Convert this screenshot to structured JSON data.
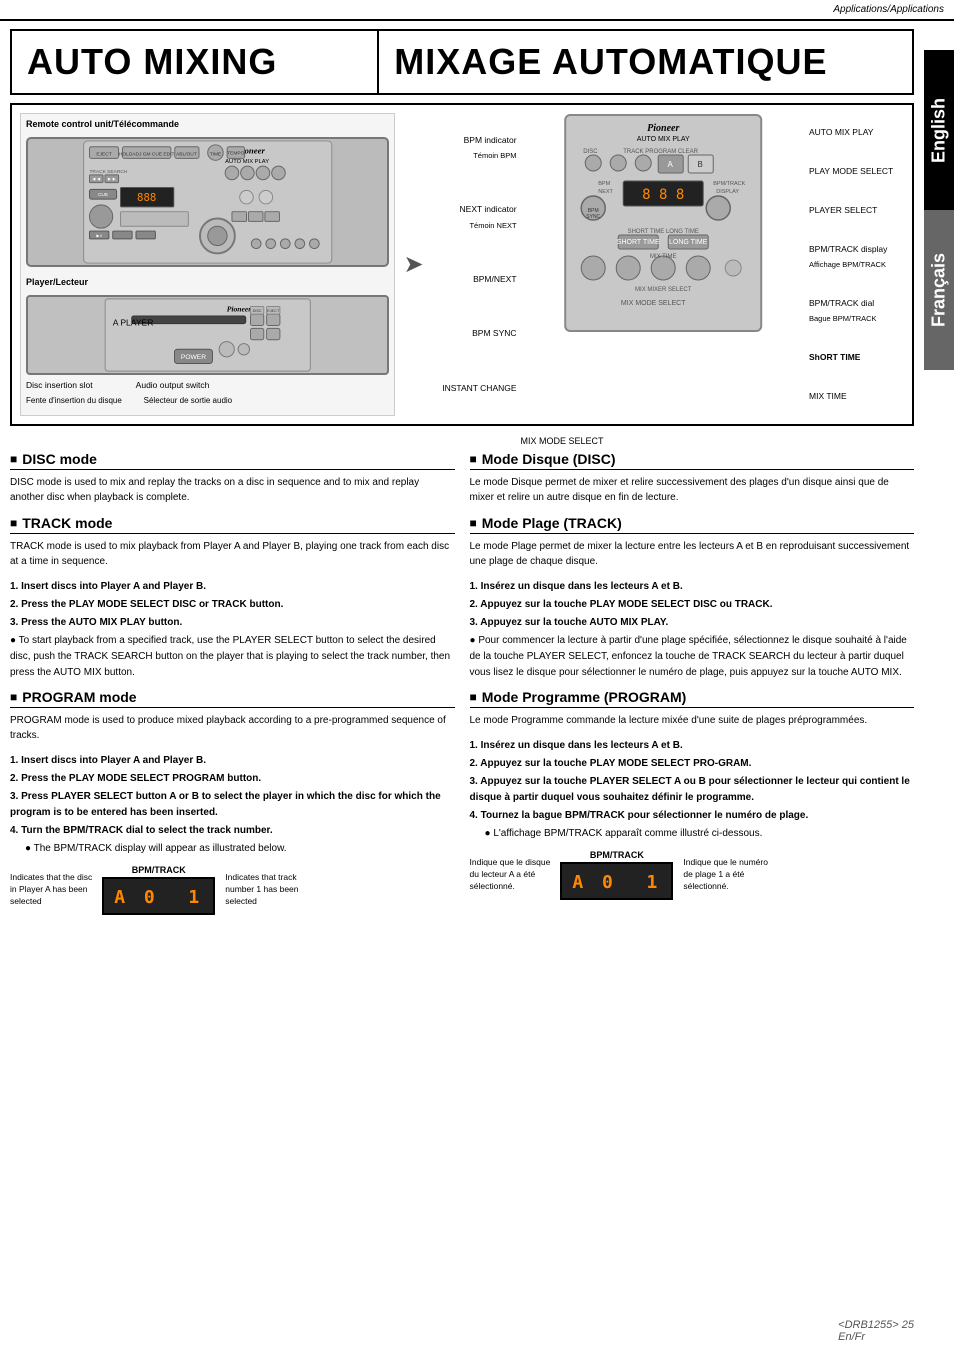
{
  "header": {
    "title": "Applications/Applications"
  },
  "side_tabs": [
    {
      "id": "english",
      "label": "English",
      "bg": "#000"
    },
    {
      "id": "francais",
      "label": "Français",
      "bg": "#555"
    }
  ],
  "titles": {
    "left": "AUTO MIXING",
    "right": "MIXAGE AUTOMATIQUE"
  },
  "diagram": {
    "remote_label": "Remote control unit/Télécommande",
    "player_label": "Player/Lecteur",
    "pioneer_logo": "Pioneer",
    "auto_mix_play": "AUTO MIX PLAY",
    "annotations_left": [
      {
        "id": "bpm-indicator",
        "label": "BPM indicator",
        "sublabel": "Témoin BPM"
      },
      {
        "id": "next-indicator",
        "label": "NEXT indicator",
        "sublabel": "Témoin NEXT"
      },
      {
        "id": "bpm-next",
        "label": "BPM/NEXT"
      },
      {
        "id": "bpm-sync",
        "label": "BPM SYNC"
      },
      {
        "id": "instant-change",
        "label": "INSTANT CHANGE"
      }
    ],
    "annotations_right": [
      {
        "id": "auto-mix-play",
        "label": "AUTO MIX PLAY"
      },
      {
        "id": "play-mode-select",
        "label": "PLAY MODE SELECT"
      },
      {
        "id": "player-select",
        "label": "PLAYER SELECT"
      },
      {
        "id": "bpm-track-display",
        "label": "BPM/TRACK display",
        "sublabel": "Affichage BPM/TRACK"
      },
      {
        "id": "bpm-track-dial",
        "label": "BPM/TRACK dial",
        "sublabel": "Bague BPM/TRACK"
      },
      {
        "id": "short-time",
        "label": "SHORT TIME"
      },
      {
        "id": "mix-time",
        "label": "MIX TIME"
      }
    ],
    "mix-mode-select": "MIX MODE SELECT",
    "disc_slot_label": "Disc insertion slot",
    "disc_slot_sublabel": "Fente d'insertion du disque",
    "audio_switch_label": "Audio output switch",
    "audio_switch_sublabel": "Sélecteur de sortie audio"
  },
  "sections": {
    "left": [
      {
        "id": "disc-mode",
        "title": "DISC mode",
        "body": "DISC mode is used to mix and replay the tracks on a disc in sequence and to mix and replay another disc when playback is complete."
      },
      {
        "id": "track-mode",
        "title": "TRACK mode",
        "body": "TRACK mode is used to mix playback from Player A and Player B, playing one track from each disc at a time in sequence."
      },
      {
        "id": "steps-disc-track",
        "steps": [
          {
            "type": "numbered",
            "text": "1. Insert discs into Player A and Player B."
          },
          {
            "type": "numbered",
            "text": "2. Press the PLAY MODE SELECT DISC or TRACK button."
          },
          {
            "type": "numbered",
            "text": "3. Press the AUTO MIX PLAY button."
          },
          {
            "type": "bullet",
            "text": "To start playback from a specified track, use the PLAYER SELECT button to select the desired disc, push the TRACK SEARCH button on the player that is playing to select the track number, then press the AUTO MIX button."
          }
        ]
      },
      {
        "id": "program-mode",
        "title": "PROGRAM mode",
        "body": "PROGRAM mode is used to produce mixed playback according to a pre-programmed sequence of tracks."
      },
      {
        "id": "steps-program",
        "steps": [
          {
            "type": "numbered",
            "text": "1. Insert discs into Player A and Player B."
          },
          {
            "type": "numbered",
            "text": "2. Press the PLAY MODE SELECT PROGRAM button."
          },
          {
            "type": "numbered",
            "text": "3. Press PLAYER SELECT button A or B to select the player in which the disc for which the program is to be entered has been inserted."
          },
          {
            "type": "numbered",
            "text": "4. Turn the BPM/TRACK dial to select the track number."
          },
          {
            "type": "sub-bullet",
            "text": "The BPM/TRACK display will appear as illustrated below."
          }
        ]
      }
    ],
    "right": [
      {
        "id": "mode-disque",
        "title": "Mode Disque (DISC)",
        "body": "Le mode Disque permet de mixer et relire successivement des plages d'un disque ainsi que de mixer et relire un autre disque en fin de lecture."
      },
      {
        "id": "mode-plage",
        "title": "Mode Plage (TRACK)",
        "body": "Le mode Plage permet de mixer la lecture entre les lecteurs A et B en reproduisant successivement une plage de chaque disque."
      },
      {
        "id": "steps-disc-track-fr",
        "steps": [
          {
            "type": "numbered-bold",
            "text": "1. Insérez un disque dans les lecteurs A et B."
          },
          {
            "type": "numbered-bold",
            "text": "2. Appuyez sur la touche PLAY MODE SELECT DISC ou TRACK."
          },
          {
            "type": "numbered-bold",
            "text": "3. Appuyez sur la touche AUTO MIX PLAY."
          },
          {
            "type": "bullet",
            "text": "Pour commencer la lecture à partir d'une plage spécifiée, sélectionnez le disque souhaité à l'aide de la touche PLAYER SELECT, enfoncez la touche de TRACK SEARCH du lecteur à partir duquel vous lisez le disque pour sélectionner le numéro de plage, puis appuyez sur la touche AUTO MIX."
          }
        ]
      },
      {
        "id": "mode-programme",
        "title": "Mode Programme (PROGRAM)",
        "body": "Le mode Programme commande la lecture mixée d'une suite de plages préprogrammées."
      },
      {
        "id": "steps-program-fr",
        "steps": [
          {
            "type": "numbered-bold",
            "text": "1. Insérez un disque dans les lecteurs A et B."
          },
          {
            "type": "numbered-bold",
            "text": "2. Appuyez sur la touche PLAY MODE SELECT PRO-GRAM."
          },
          {
            "type": "numbered-bold",
            "text": "3. Appuyez sur la touche PLAYER SELECT A ou B pour sélectionner le lecteur qui contient le disque à partir duquel vous souhaitez définir le programme."
          },
          {
            "type": "numbered-bold",
            "text": "4. Tournez la bague BPM/TRACK pour sélectionner le numéro de plage."
          },
          {
            "type": "sub-bullet",
            "text": "L'affichage BPM/TRACK apparaît comme illustré ci-dessous."
          }
        ]
      }
    ]
  },
  "bpm_display": {
    "label": "BPM/TRACK",
    "value": "A 0  1",
    "left_note_line1": "Indicates that the disc",
    "left_note_line2": "in Player A has been",
    "left_note_line3": "selected",
    "right_note_line1": "Indicates that track",
    "right_note_line2": "number 1 has been",
    "right_note_line3": "selected"
  },
  "bpm_display_fr": {
    "label": "BPM/TRACK",
    "value": "A 0  1",
    "left_note_line1": "Indique que le disque",
    "left_note_line2": "du lecteur A a été",
    "left_note_line3": "sélectionné.",
    "right_note_line1": "Indique que le numéro",
    "right_note_line2": "de plage 1 a été",
    "right_note_line3": "sélectionné."
  },
  "footer": {
    "page": "<DRB1255> 25",
    "lang": "En/Fr"
  }
}
